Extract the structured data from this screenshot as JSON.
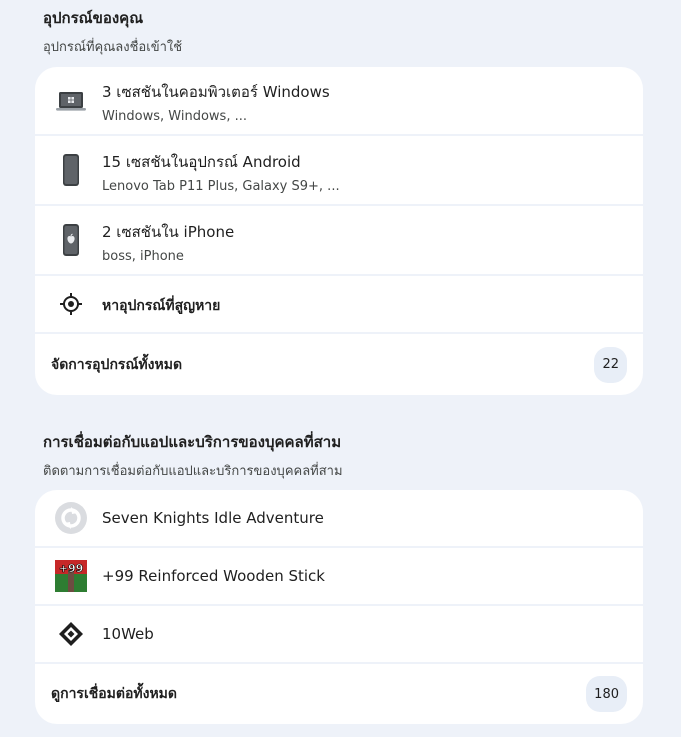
{
  "devices": {
    "title": "อุปกรณ์ของคุณ",
    "subtitle": "อุปกรณ์ที่คุณลงชื่อเข้าใช้",
    "items": [
      {
        "icon": "laptop-icon",
        "title": "3 เซสชันในคอมพิวเตอร์ Windows",
        "detail": "Windows, Windows, ..."
      },
      {
        "icon": "android-phone-icon",
        "title": "15 เซสชันในอุปกรณ์ Android",
        "detail": "Lenovo Tab P11 Plus, Galaxy S9+, ..."
      },
      {
        "icon": "iphone-icon",
        "title": "2 เซสชันใน iPhone",
        "detail": "boss, iPhone"
      }
    ],
    "find_device": {
      "icon": "target-icon",
      "label": "หาอุปกรณ์ที่สูญหาย"
    },
    "manage": {
      "label": "จัดการอุปกรณ์ทั้งหมด",
      "count": "22"
    }
  },
  "connections": {
    "title": "การเชื่อมต่อกับแอปและบริการของบุคคลที่สาม",
    "subtitle": "ติดตามการเชื่อมต่อกับแอปและบริการของบุคคลที่สาม",
    "items": [
      {
        "icon": "seven-knights-app-icon",
        "label": "Seven Knights Idle Adventure"
      },
      {
        "icon": "wooden-stick-app-icon",
        "label": "+99 Reinforced Wooden Stick",
        "icon_text": "+99"
      },
      {
        "icon": "10web-logo-icon",
        "label": "10Web"
      }
    ],
    "view_all": {
      "label": "ดูการเชื่อมต่อทั้งหมด",
      "count": "180"
    }
  },
  "colors": {
    "background": "#eef2f9",
    "card": "#ffffff",
    "badge": "#e8eef7",
    "text_primary": "#1f1f1f",
    "text_secondary": "#444746"
  }
}
